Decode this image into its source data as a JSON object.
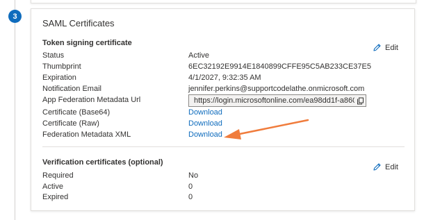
{
  "step": {
    "number": "3"
  },
  "card": {
    "title": "SAML Certificates",
    "token_section": {
      "heading": "Token signing certificate",
      "edit_label": "Edit",
      "rows": {
        "status": {
          "label": "Status",
          "value": "Active"
        },
        "thumbprint": {
          "label": "Thumbprint",
          "value": "6EC32192E9914E1840899CFFE95C5AB233CE37E5"
        },
        "expiration": {
          "label": "Expiration",
          "value": "4/1/2027, 9:32:35 AM"
        },
        "notification_email": {
          "label": "Notification Email",
          "value": "jennifer.perkins@supportcodelathe.onmicrosoft.com"
        },
        "metadata_url": {
          "label": "App Federation Metadata Url",
          "value": "https://login.microsoftonline.com/ea98dd1f-a860-..."
        },
        "cert_base64": {
          "label": "Certificate (Base64)",
          "value": "Download"
        },
        "cert_raw": {
          "label": "Certificate (Raw)",
          "value": "Download"
        },
        "federation_xml": {
          "label": "Federation Metadata XML",
          "value": "Download"
        }
      }
    },
    "verification_section": {
      "heading": "Verification certificates (optional)",
      "edit_label": "Edit",
      "rows": {
        "required": {
          "label": "Required",
          "value": "No"
        },
        "active": {
          "label": "Active",
          "value": "0"
        },
        "expired": {
          "label": "Expired",
          "value": "0"
        }
      }
    }
  },
  "colors": {
    "accent": "#0f6cbd",
    "annotation_arrow": "#f07c3c"
  },
  "icons": {
    "edit": "pencil-icon",
    "copy": "copy-icon"
  }
}
